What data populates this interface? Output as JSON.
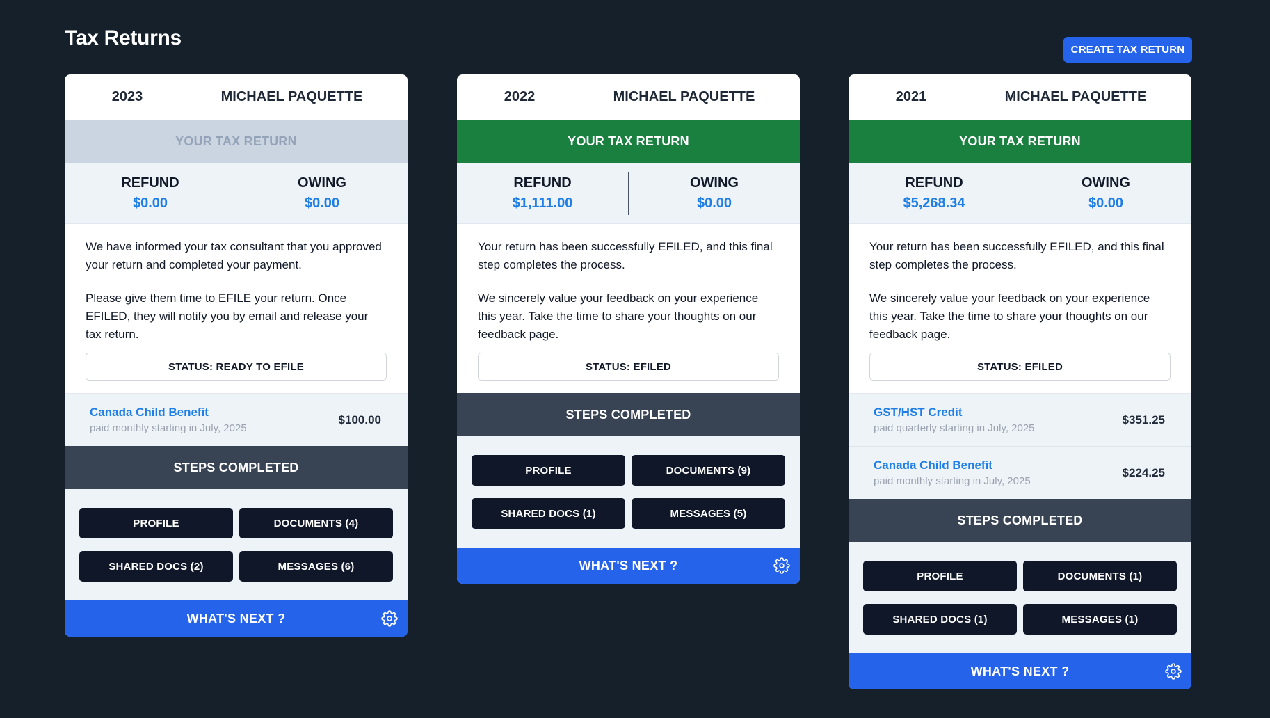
{
  "page": {
    "title": "Tax Returns",
    "create_button": "CREATE TAX RETURN"
  },
  "cards": [
    {
      "year": "2023",
      "name": "MICHAEL PAQUETTE",
      "banner": "YOUR TAX RETURN",
      "refund_label": "REFUND",
      "refund_value": "$0.00",
      "owing_label": "OWING",
      "owing_value": "$0.00",
      "message_1": "We have informed your tax consultant that you approved your return and completed your payment.",
      "message_2": "Please give them time to EFILE your return. Once EFILED, they will notify you by email and release your tax return.",
      "status": "STATUS: READY TO EFILE",
      "benefits": [
        {
          "name": "Canada Child Benefit",
          "sub": "paid monthly starting in July, 2025",
          "amount": "$100.00"
        }
      ],
      "steps_header": "STEPS COMPLETED",
      "steps": [
        "PROFILE",
        "DOCUMENTS (4)",
        "SHARED DOCS (2)",
        "MESSAGES (6)"
      ],
      "whats_next": "WHAT'S NEXT ?"
    },
    {
      "year": "2022",
      "name": "MICHAEL PAQUETTE",
      "banner": "YOUR TAX RETURN",
      "refund_label": "REFUND",
      "refund_value": "$1,111.00",
      "owing_label": "OWING",
      "owing_value": "$0.00",
      "message_1": "Your return has been successfully EFILED, and this final step completes the process.",
      "message_2": "We sincerely value your feedback on your experience this year. Take the time to share your thoughts on our feedback page.",
      "status": "STATUS: EFILED",
      "benefits": [],
      "steps_header": "STEPS COMPLETED",
      "steps": [
        "PROFILE",
        "DOCUMENTS (9)",
        "SHARED DOCS (1)",
        "MESSAGES (5)"
      ],
      "whats_next": "WHAT'S NEXT ?"
    },
    {
      "year": "2021",
      "name": "MICHAEL PAQUETTE",
      "banner": "YOUR TAX RETURN",
      "refund_label": "REFUND",
      "refund_value": "$5,268.34",
      "owing_label": "OWING",
      "owing_value": "$0.00",
      "message_1": "Your return has been successfully EFILED, and this final step completes the process.",
      "message_2": "We sincerely value your feedback on your experience this year. Take the time to share your thoughts on our feedback page.",
      "status": "STATUS: EFILED",
      "benefits": [
        {
          "name": "GST/HST Credit",
          "sub": "paid quarterly starting in July, 2025",
          "amount": "$351.25"
        },
        {
          "name": "Canada Child Benefit",
          "sub": "paid monthly starting in July, 2025",
          "amount": "$224.25"
        }
      ],
      "steps_header": "STEPS COMPLETED",
      "steps": [
        "PROFILE",
        "DOCUMENTS (1)",
        "SHARED DOCS (1)",
        "MESSAGES (1)"
      ],
      "whats_next": "WHAT'S NEXT ?"
    }
  ],
  "colors": {
    "background": "#16202a",
    "accent_blue": "#2563eb",
    "efiled_green": "#1a8040",
    "pending_gray": "#cbd5e1",
    "amount_blue": "#1e7ee6",
    "steps_header": "#384353",
    "step_button": "#0f1729"
  },
  "icons": {
    "whats_next": "gear-icon"
  }
}
